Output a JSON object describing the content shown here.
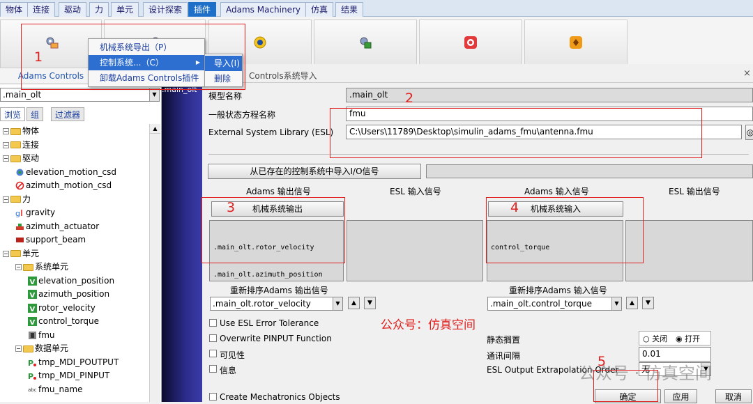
{
  "tabs": [
    "物体",
    "连接",
    "驱动",
    "力",
    "单元",
    "设计探索",
    "插件",
    "Adams Machinery",
    "仿真",
    "结果"
  ],
  "active_tab": 6,
  "ribbon": {
    "adams_controls_label": "Adams Controls"
  },
  "context_menu": {
    "items": [
      "机械系统导出（P）",
      "控制系统...（C）",
      "卸载Adams Controls插件"
    ],
    "highlighted": 1
  },
  "submenu": {
    "items": [
      "导入(I)",
      "删除"
    ],
    "highlighted": 0
  },
  "left_panel": {
    "model_combo": ".main_olt",
    "tabs": [
      "浏览",
      "组",
      "过滤器"
    ],
    "tree": [
      {
        "level": 0,
        "label": "物体",
        "type": "folder"
      },
      {
        "level": 0,
        "label": "连接",
        "type": "folder"
      },
      {
        "level": 0,
        "label": "驱动",
        "type": "folder"
      },
      {
        "level": 1,
        "label": "elevation_motion_csd",
        "type": "motion"
      },
      {
        "level": 1,
        "label": "azimuth_motion_csd",
        "type": "motion-disabled"
      },
      {
        "level": 0,
        "label": "力",
        "type": "folder"
      },
      {
        "level": 1,
        "label": "gravity",
        "type": "gravity"
      },
      {
        "level": 1,
        "label": "azimuth_actuator",
        "type": "actuator"
      },
      {
        "level": 1,
        "label": "support_beam",
        "type": "beam"
      },
      {
        "level": 0,
        "label": "单元",
        "type": "folder"
      },
      {
        "level": 1,
        "label": "系统单元",
        "type": "folder"
      },
      {
        "level": 2,
        "label": "elevation_position",
        "type": "variable"
      },
      {
        "level": 2,
        "label": "azimuth_position",
        "type": "variable"
      },
      {
        "level": 2,
        "label": "rotor_velocity",
        "type": "variable"
      },
      {
        "level": 2,
        "label": "control_torque",
        "type": "variable"
      },
      {
        "level": 2,
        "label": "fmu",
        "type": "fmu"
      },
      {
        "level": 1,
        "label": "数据单元",
        "type": "folder"
      },
      {
        "level": 2,
        "label": "tmp_MDI_POUTPUT",
        "type": "pinput"
      },
      {
        "level": 2,
        "label": "tmp_MDI_PINPUT",
        "type": "pinput"
      },
      {
        "level": 2,
        "label": "fmu_name",
        "type": "string"
      }
    ]
  },
  "strip_label": ".main_olt",
  "dialog": {
    "title": "Controls系统导入",
    "model_name_label": "模型名称",
    "model_name_value": ".main_olt",
    "gse_label": "一般状态方程名称",
    "gse_value": "fmu",
    "esl_label": "External System Library (ESL)",
    "esl_value": "C:\\Users\\11789\\Desktop\\simulin_adams_fmu\\antenna.fmu",
    "import_io_button": "从已存在的控制系统中导入I/O信号",
    "col_headers": [
      "Adams 输出信号",
      "ESL 输入信号",
      "Adams 输入信号",
      "ESL 输出信号"
    ],
    "mech_output_button": "机械系统输出",
    "mech_input_button": "机械系统输入",
    "adams_outputs": [
      ".main_olt.rotor_velocity",
      ".main_olt.azimuth_position"
    ],
    "adams_inputs": [
      "control_torque"
    ],
    "reorder_out_label": "重新排序Adams 输出信号",
    "reorder_out_value": ".main_olt.rotor_velocity",
    "reorder_in_label": "重新排序Adams 输入信号",
    "reorder_in_value": ".main_olt.control_torque",
    "checkboxes": [
      "Use ESL Error Tolerance",
      "Overwrite PINPUT Function",
      "可见性",
      "信息",
      "Create Mechatronics Objects"
    ],
    "static_hold_label": "静态搁置",
    "radio_off": "关闭",
    "radio_on": "打开",
    "radio_selected": "打开",
    "comm_interval_label": "通讯间隔",
    "comm_interval_value": "0.01",
    "extrap_label": "ESL Output Extrapolation Order",
    "extrap_value": "无",
    "ok_button": "确定",
    "apply_button": "应用",
    "cancel_button": "取消"
  },
  "watermark": {
    "red_text": "公众号：仿真空间",
    "grey_text": "公众号 · 仿真空间"
  },
  "annotations": [
    "1",
    "2",
    "3",
    "4",
    "5"
  ],
  "colors": {
    "annotation_red": "#e0201e",
    "active_tab_blue": "#1e6fc8",
    "menu_highlight": "#2d6fd1"
  }
}
